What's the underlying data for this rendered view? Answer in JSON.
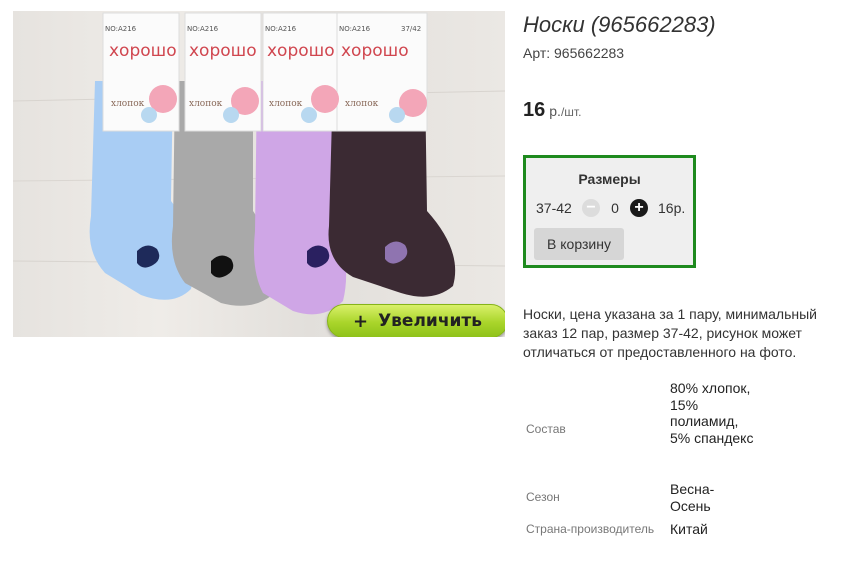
{
  "product": {
    "title": "Носки (965662283)",
    "sku": "Арт: 965662283",
    "price": {
      "value": "16",
      "currency": "р.",
      "unit": "/шт."
    },
    "description": "Носки, цена указана за 1 пару, минимальный заказ 12 пар, размер 37-42, рисунок может отличаться от предоставленного на фото."
  },
  "photo": {
    "zoom_label": "Увеличить",
    "zoom_icon": "+",
    "brand_text": "хорошо",
    "tag_code": "NO:A216",
    "tag_size": "37/42",
    "tag_material": "хлопок",
    "sock_colors": [
      "#a9cdf4",
      "#a9a9a9",
      "#cfa6e6",
      "#3b2a33"
    ]
  },
  "sizes": {
    "title": "Размеры",
    "rows": [
      {
        "size": "37-42",
        "qty": "0",
        "price": "16р."
      }
    ],
    "minus_icon": "−",
    "plus_icon": "+",
    "cart_label": "В корзину",
    "border_color": "#1e8a1e"
  },
  "properties": [
    {
      "label": "Состав",
      "value": "80% хлопок, 15% полиамид, 5% спандекс"
    },
    {
      "label": "Сезон",
      "value": "Весна-Осень"
    },
    {
      "label": "Страна-производитель",
      "value": "Китай"
    }
  ]
}
